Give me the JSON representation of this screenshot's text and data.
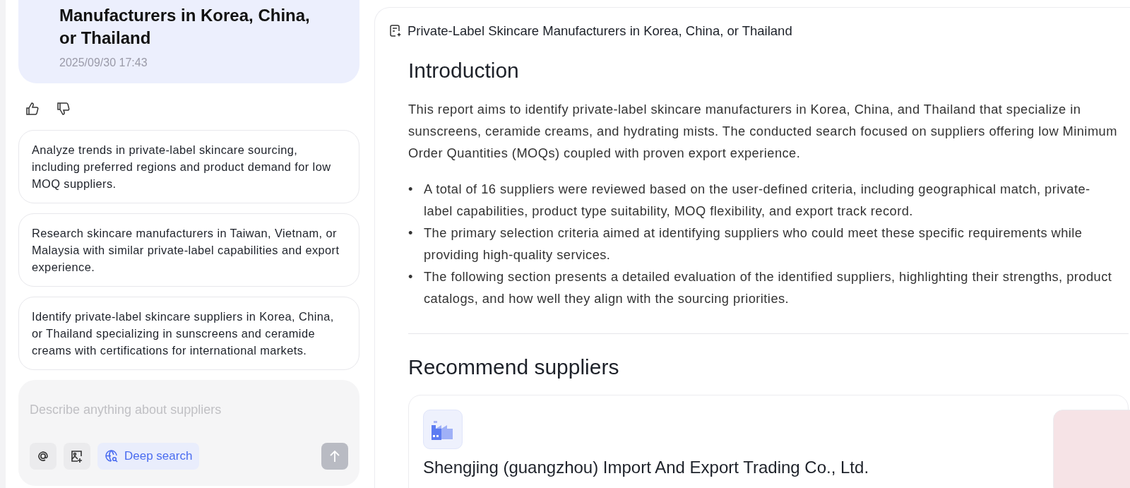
{
  "chat": {
    "query_title": "Manufacturers in Korea, China, or Thailand",
    "query_time": "2025/09/30 17:43",
    "suggestions": [
      "Analyze trends in private-label skincare sourcing, including preferred regions and product demand for low MOQ suppliers.",
      "Research skincare manufacturers in Taiwan, Vietnam, or Malaysia with similar private-label capabilities and export experience.",
      "Identify private-label skincare suppliers in Korea, China, or Thailand specializing in sunscreens and ceramide creams with certifications for international markets."
    ],
    "input": {
      "placeholder": "Describe anything about suppliers"
    },
    "deep_search": {
      "label": "Deep search",
      "on": true
    }
  },
  "report": {
    "title": "Private-Label Skincare Manufacturers in Korea, China, or Thailand",
    "sections": [
      {
        "heading": "Introduction",
        "paragraph": "This report aims to identify private-label skincare manufacturers in Korea, China, and Thailand that specialize in sunscreens, ceramide creams, and hydrating mists. The conducted search focused on suppliers offering low Minimum Order Quantities (MOQs) coupled with proven export experience.",
        "bullets": [
          {
            "marker": "•",
            "text": "A total of 16 suppliers were reviewed based on the user-defined criteria, including geographical match, private-label capabilities, product type suitability, MOQ flexibility, and export track record."
          },
          {
            "marker": "•",
            "text": "The primary selection criteria aimed at identifying suppliers who could meet these specific requirements while providing high-quality services."
          },
          {
            "marker": "•",
            "text": "The following section presents a detailed evaluation of the identified suppliers, highlighting their strengths, product catalogs, and how well they align with the sourcing priorities."
          }
        ]
      },
      {
        "heading": "Recommend suppliers",
        "suppliers": [
          {
            "name": "Shengjing (guangzhou) Import And Export Trading Co., Ltd."
          }
        ]
      }
    ]
  }
}
